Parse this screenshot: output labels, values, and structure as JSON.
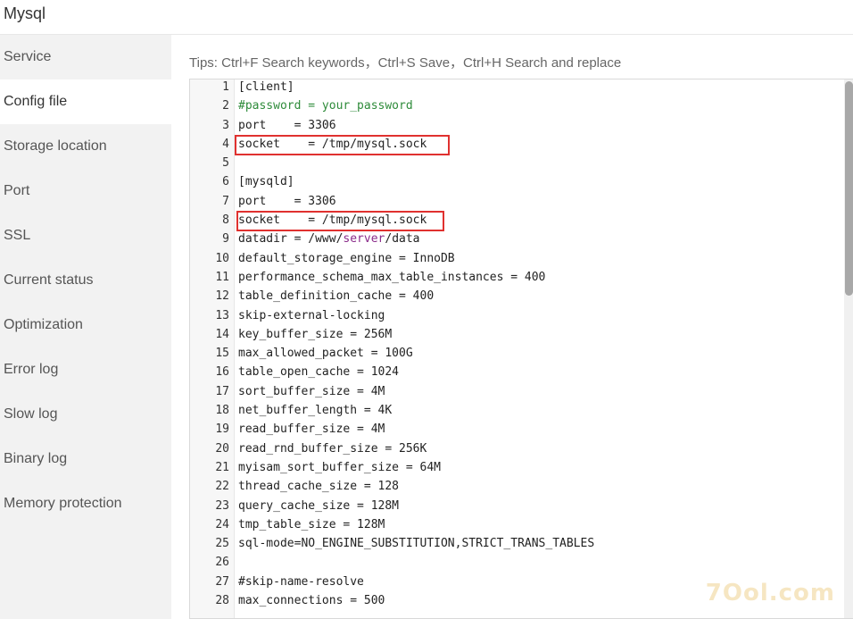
{
  "window": {
    "title": "Mysql"
  },
  "sidebar": {
    "items": [
      {
        "label": "Service"
      },
      {
        "label": "Config file"
      },
      {
        "label": "Storage location"
      },
      {
        "label": "Port"
      },
      {
        "label": "SSL"
      },
      {
        "label": "Current status"
      },
      {
        "label": "Optimization"
      },
      {
        "label": "Error log"
      },
      {
        "label": "Slow log"
      },
      {
        "label": "Binary log"
      },
      {
        "label": "Memory protection"
      }
    ],
    "active": "Config file"
  },
  "tips": "Tips:  Ctrl+F Search keywords，Ctrl+S Save，Ctrl+H Search and replace",
  "editor": {
    "lines": [
      "[client]",
      "#password = your_password",
      "port    = 3306",
      "socket    = /tmp/mysql.sock",
      "",
      "[mysqld]",
      "port    = 3306",
      "socket    = /tmp/mysql.sock",
      "datadir = /www/server/data",
      "default_storage_engine = InnoDB",
      "performance_schema_max_table_instances = 400",
      "table_definition_cache = 400",
      "skip-external-locking",
      "key_buffer_size = 256M",
      "max_allowed_packet = 100G",
      "table_open_cache = 1024",
      "sort_buffer_size = 4M",
      "net_buffer_length = 4K",
      "read_buffer_size = 4M",
      "read_rnd_buffer_size = 256K",
      "myisam_sort_buffer_size = 64M",
      "thread_cache_size = 128",
      "query_cache_size = 128M",
      "tmp_table_size = 128M",
      "sql-mode=NO_ENGINE_SUBSTITUTION,STRICT_TRANS_TABLES",
      "",
      "#skip-name-resolve",
      "max_connections = 500"
    ],
    "highlighted_lines": [
      4,
      8
    ],
    "colors": {
      "comment": "#2e8b3a",
      "keyword": "#8a2b8a",
      "highlight_border": "#e0312f"
    }
  },
  "watermark": "7Ool.com"
}
